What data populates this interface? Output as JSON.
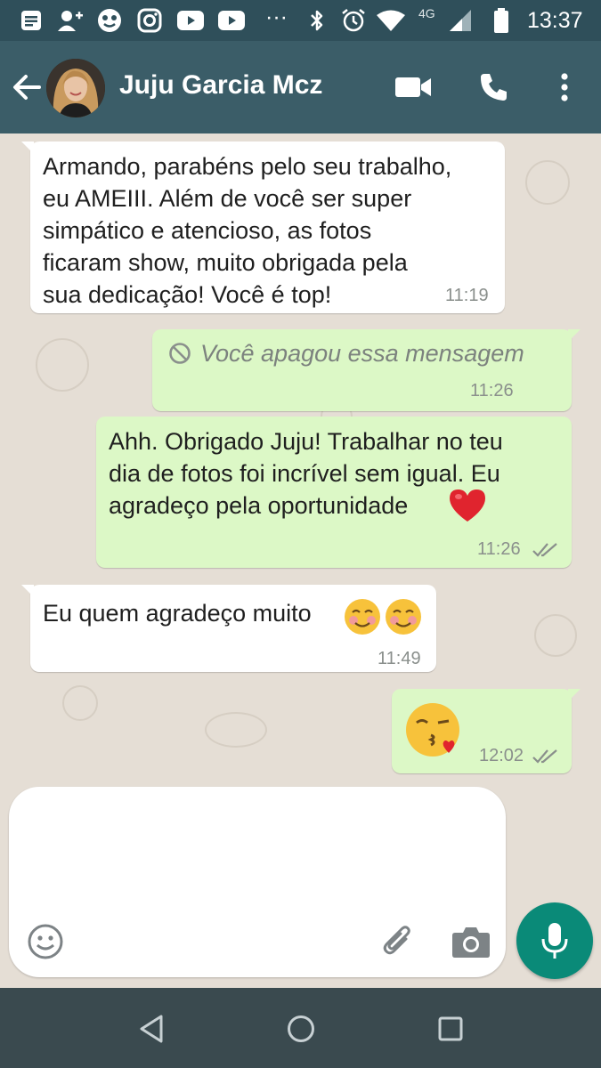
{
  "status_bar": {
    "time": "13:37",
    "network": "4G",
    "more": "···",
    "icons": [
      "notes-icon",
      "add-contact-icon",
      "emoji-app-icon",
      "instagram-icon",
      "youtube-icon",
      "youtube-icon",
      "bluetooth-icon",
      "alarm-icon",
      "wifi-icon",
      "signal-icon",
      "battery-icon"
    ]
  },
  "header": {
    "contact_name": "Juju Garcia Mcz",
    "icons": [
      "back-arrow-icon",
      "video-call-icon",
      "phone-icon",
      "more-vert-icon"
    ]
  },
  "messages": [
    {
      "direction": "incoming",
      "text": "Armando, parabéns pelo seu trabalho,\neu AMEIII. Além de você ser super\nsimpático e atencioso, as fotos\nficaram show, muito obrigada pela\nsua dedicação! Você é top!",
      "time": "11:19"
    },
    {
      "direction": "outgoing",
      "deleted": true,
      "text": "Você apagou essa mensagem",
      "time": "11:26"
    },
    {
      "direction": "outgoing",
      "text": "Ahh. Obrigado Juju! Trabalhar no teu\ndia de fotos foi incrível sem igual. Eu\nagradeço pela oportunidade",
      "emoji": "❤️",
      "time": "11:26",
      "status": "read"
    },
    {
      "direction": "incoming",
      "text": "Eu quem agradeço muito",
      "emoji": "☺️☺️",
      "time": "11:49"
    },
    {
      "direction": "outgoing",
      "emoji": "😘",
      "time": "12:02",
      "status": "read"
    }
  ],
  "composer": {
    "value": "",
    "icons": [
      "emoji-icon",
      "attach-icon",
      "camera-icon",
      "mic-icon"
    ]
  },
  "nav_bar": {
    "icons": [
      "back-triangle-icon",
      "home-circle-icon",
      "recents-square-icon"
    ]
  },
  "colors": {
    "header": "#3b5d68",
    "status_bar": "#2f4f5a",
    "outgoing_bubble": "#dcf8c6",
    "incoming_bubble": "#ffffff",
    "chat_background": "#e5ded5",
    "mic_button": "#0a8a78",
    "nav_bar": "#3a4a4f"
  }
}
